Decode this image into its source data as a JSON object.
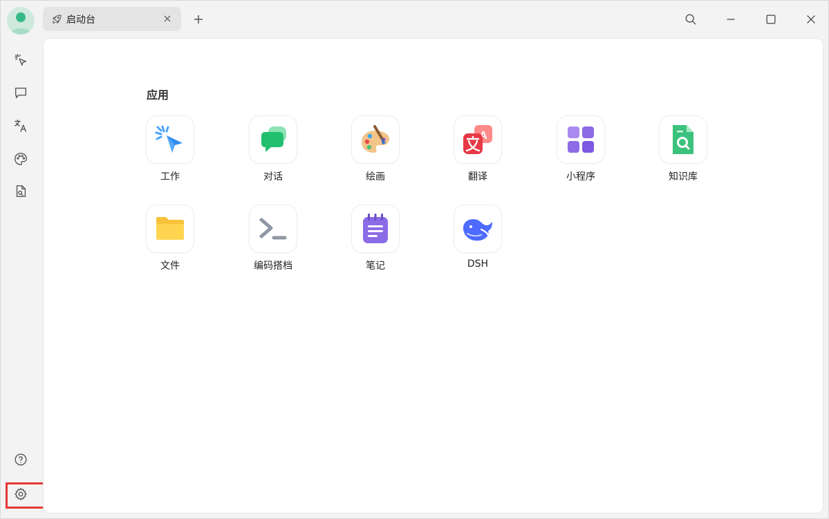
{
  "tab": {
    "label": "启动台"
  },
  "main": {
    "section_title": "应用"
  },
  "apps": [
    {
      "label": "工作"
    },
    {
      "label": "对话"
    },
    {
      "label": "绘画"
    },
    {
      "label": "翻译"
    },
    {
      "label": "小程序"
    },
    {
      "label": "知识库"
    },
    {
      "label": "文件"
    },
    {
      "label": "编码搭档"
    },
    {
      "label": "笔记"
    },
    {
      "label": "DSH"
    }
  ],
  "icons": {
    "sidebar": [
      "cursor-sparkle-icon",
      "chat-bubble-icon",
      "translate-icon",
      "palette-icon",
      "document-search-icon",
      "help-icon",
      "gear-icon"
    ],
    "tab": "rocket-icon",
    "window": [
      "search-icon",
      "minimize-icon",
      "maximize-icon",
      "close-icon"
    ]
  },
  "colors": {
    "highlight": "#e53935",
    "avatar": "#35b98a"
  }
}
